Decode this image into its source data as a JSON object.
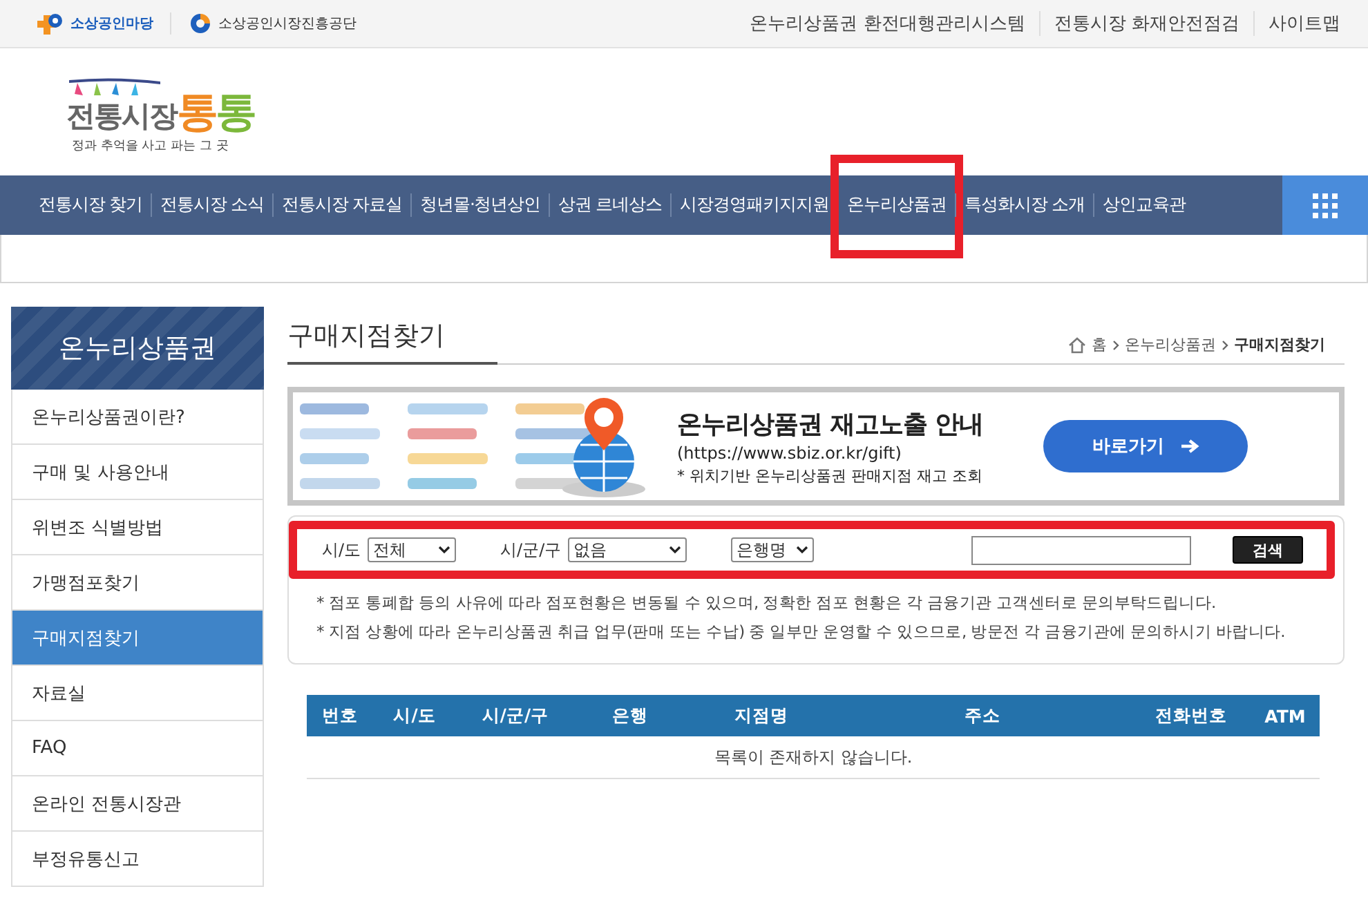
{
  "top_bar": {
    "brands": [
      {
        "kind": "plus",
        "label": "소상공인마당"
      },
      {
        "kind": "swirl",
        "label": "소상공인시장진흥공단"
      }
    ],
    "links": [
      "온누리상품권 환전대행관리시스템",
      "전통시장 화재안전점검",
      "사이트맵"
    ]
  },
  "logo": {
    "main": "전통시장",
    "accent": [
      "통",
      "통"
    ],
    "tagline": "정과 추억을 사고 파는 그 곳"
  },
  "nav": {
    "items": [
      {
        "label": "전통시장 찾기",
        "highlighted": false
      },
      {
        "label": "전통시장 소식",
        "highlighted": false
      },
      {
        "label": "전통시장 자료실",
        "highlighted": false
      },
      {
        "label": "청년몰·청년상인",
        "highlighted": false
      },
      {
        "label": "상권 르네상스",
        "highlighted": false
      },
      {
        "label": "시장경영패키지지원",
        "highlighted": false
      },
      {
        "label": "온누리상품권",
        "highlighted": true
      },
      {
        "label": "특성화시장 소개",
        "highlighted": false
      },
      {
        "label": "상인교육관",
        "highlighted": false
      }
    ]
  },
  "sidebar": {
    "title": "온누리상품권",
    "items": [
      {
        "label": "온누리상품권이란?",
        "selected": false
      },
      {
        "label": "구매 및 사용안내",
        "selected": false
      },
      {
        "label": "위변조 식별방법",
        "selected": false
      },
      {
        "label": "가맹점포찾기",
        "selected": false
      },
      {
        "label": "구매지점찾기",
        "selected": true
      },
      {
        "label": "자료실",
        "selected": false
      },
      {
        "label": "FAQ",
        "selected": false
      },
      {
        "label": "온라인 전통시장관",
        "selected": false
      },
      {
        "label": "부정유통신고",
        "selected": false
      }
    ]
  },
  "page_title": "구매지점찾기",
  "breadcrumb": [
    "홈",
    "온누리상품권",
    "구매지점찾기"
  ],
  "banner": {
    "title": "온누리상품권 재고노출 안내",
    "url": "(https://www.sbiz.or.kr/gift)",
    "note": "* 위치기반 온누리상품권 판매지점 재고 조회",
    "button": "바로가기"
  },
  "search": {
    "highlighted": true,
    "fields": [
      {
        "kind": "select",
        "label": "시/도",
        "value": "전체"
      },
      {
        "kind": "select",
        "label": "시/군/구",
        "value": "없음"
      },
      {
        "kind": "select",
        "value": "은행명"
      },
      {
        "kind": "text"
      }
    ],
    "button": "검색"
  },
  "notes": [
    "* 점포 통폐합 등의 사유에 따라 점포현황은 변동될 수 있으며, 정확한 점포 현황은 각 금융기관 고객센터로 문의부탁드립니다.",
    "* 지점 상황에 따라 온누리상품권 취급 업무(판매 또는 수납) 중 일부만 운영할 수 있으므로, 방문전 각 금융기관에 문의하시기 바랍니다."
  ],
  "table": {
    "columns": [
      "번호",
      "시/도",
      "시/군/구",
      "은행",
      "지점명",
      "주소",
      "전화번호",
      "ATM"
    ],
    "empty_message": "목록이 존재하지 않습니다."
  }
}
